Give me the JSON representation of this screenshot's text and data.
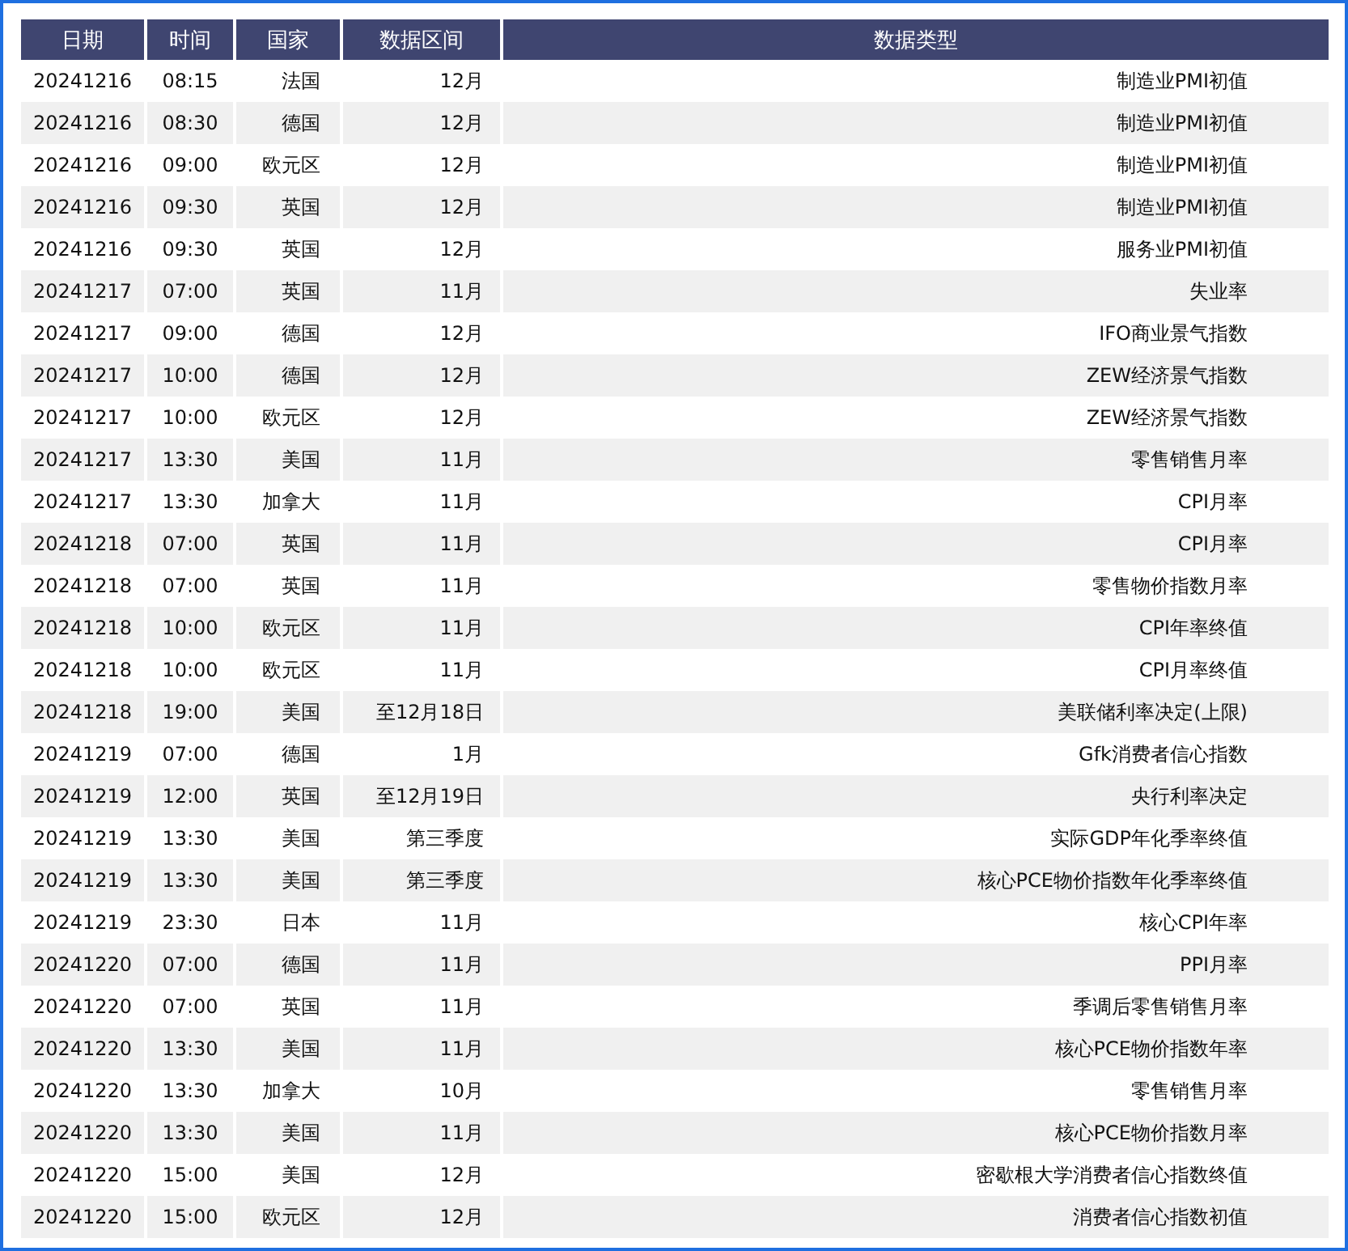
{
  "table": {
    "columns": [
      "日期",
      "时间",
      "国家",
      "数据区间",
      "数据类型"
    ],
    "rows": [
      [
        "20241216",
        "08:15",
        "法国",
        "12月",
        "制造业PMI初值"
      ],
      [
        "20241216",
        "08:30",
        "德国",
        "12月",
        "制造业PMI初值"
      ],
      [
        "20241216",
        "09:00",
        "欧元区",
        "12月",
        "制造业PMI初值"
      ],
      [
        "20241216",
        "09:30",
        "英国",
        "12月",
        "制造业PMI初值"
      ],
      [
        "20241216",
        "09:30",
        "英国",
        "12月",
        "服务业PMI初值"
      ],
      [
        "20241217",
        "07:00",
        "英国",
        "11月",
        "失业率"
      ],
      [
        "20241217",
        "09:00",
        "德国",
        "12月",
        "IFO商业景气指数"
      ],
      [
        "20241217",
        "10:00",
        "德国",
        "12月",
        "ZEW经济景气指数"
      ],
      [
        "20241217",
        "10:00",
        "欧元区",
        "12月",
        "ZEW经济景气指数"
      ],
      [
        "20241217",
        "13:30",
        "美国",
        "11月",
        "零售销售月率"
      ],
      [
        "20241217",
        "13:30",
        "加拿大",
        "11月",
        "CPI月率"
      ],
      [
        "20241218",
        "07:00",
        "英国",
        "11月",
        "CPI月率"
      ],
      [
        "20241218",
        "07:00",
        "英国",
        "11月",
        "零售物价指数月率"
      ],
      [
        "20241218",
        "10:00",
        "欧元区",
        "11月",
        "CPI年率终值"
      ],
      [
        "20241218",
        "10:00",
        "欧元区",
        "11月",
        "CPI月率终值"
      ],
      [
        "20241218",
        "19:00",
        "美国",
        "至12月18日",
        "美联储利率决定(上限)"
      ],
      [
        "20241219",
        "07:00",
        "德国",
        "1月",
        "Gfk消费者信心指数"
      ],
      [
        "20241219",
        "12:00",
        "英国",
        "至12月19日",
        "央行利率决定"
      ],
      [
        "20241219",
        "13:30",
        "美国",
        "第三季度",
        "实际GDP年化季率终值"
      ],
      [
        "20241219",
        "13:30",
        "美国",
        "第三季度",
        "核心PCE物价指数年化季率终值"
      ],
      [
        "20241219",
        "23:30",
        "日本",
        "11月",
        "核心CPI年率"
      ],
      [
        "20241220",
        "07:00",
        "德国",
        "11月",
        "PPI月率"
      ],
      [
        "20241220",
        "07:00",
        "英国",
        "11月",
        "季调后零售销售月率"
      ],
      [
        "20241220",
        "13:30",
        "美国",
        "11月",
        "核心PCE物价指数年率"
      ],
      [
        "20241220",
        "13:30",
        "加拿大",
        "10月",
        "零售销售月率"
      ],
      [
        "20241220",
        "13:30",
        "美国",
        "11月",
        "核心PCE物价指数月率"
      ],
      [
        "20241220",
        "15:00",
        "美国",
        "12月",
        "密歇根大学消费者信心指数终值"
      ],
      [
        "20241220",
        "15:00",
        "欧元区",
        "12月",
        "消费者信心指数初值"
      ]
    ]
  }
}
